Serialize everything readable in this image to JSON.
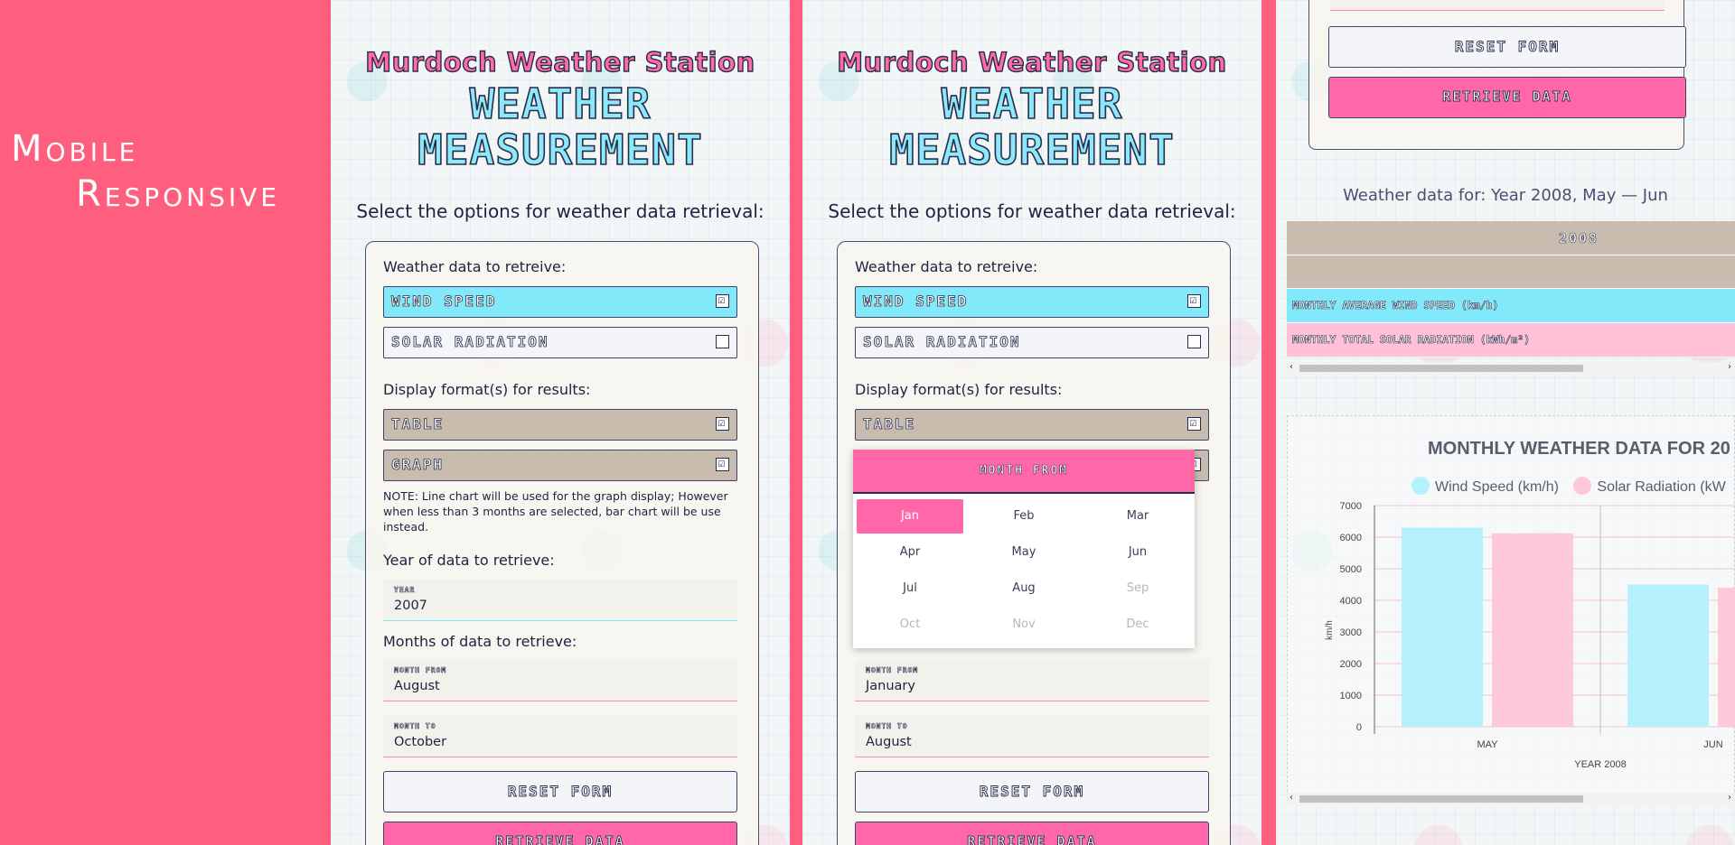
{
  "side_title": {
    "line1": "Mobile",
    "line2": "Responsive"
  },
  "form": {
    "station": "Murdoch Weather Station",
    "heading_line1": "WEATHER",
    "heading_line2": "MEASUREMENT",
    "select_prompt": "Select the options for weather data retrieval:",
    "data_label": "Weather data to retreive:",
    "wind_label": "WIND SPEED",
    "solar_label": "SOLAR RADIATION",
    "format_label": "Display format(s) for results:",
    "table_label": "TABLE",
    "graph_label": "GRAPH",
    "note": "NOTE: Line chart will be used for the graph display; However when less than 3 months are selected, bar chart will be use instead.",
    "year_label": "Year of data to retrieve:",
    "year_small": "YEAR",
    "months_label": "Months of data to retrieve:",
    "month_from_small": "MONTH FROM",
    "month_to_small": "MONTH TO",
    "reset_label": "RESET FORM",
    "retrieve_label": "RETRIEVE DATA",
    "check_mark": "☑"
  },
  "panel1": {
    "year_value": "2007",
    "month_from_value": "August",
    "month_to_value": "October"
  },
  "panel2": {
    "month_from_value": "January",
    "month_to_value": "August",
    "picker_title": "MONTH FROM",
    "months": [
      "Jan",
      "Feb",
      "Mar",
      "Apr",
      "May",
      "Jun",
      "Jul",
      "Aug",
      "Sep",
      "Oct",
      "Nov",
      "Dec"
    ],
    "selected": "Jan",
    "disabled": [
      "Sep",
      "Oct",
      "Nov",
      "Dec"
    ]
  },
  "panel3": {
    "data_for": "Weather data for: Year 2008, May — Jun",
    "table_year": "2008",
    "row_wind": "MONTHLY AVERAGE WIND SPEED (km/h)",
    "row_solar": "MONTHLY TOTAL SOLAR RADIATION (kWh/m²)",
    "scroll_left": "‹",
    "scroll_right": "›"
  },
  "colors": {
    "wind": "#82e9fb",
    "solar": "#ffc0d8",
    "accent": "#ff67a8",
    "background": "#ff5f7e"
  },
  "chart_data": {
    "type": "bar",
    "title": "MONTHLY WEATHER DATA FOR 20",
    "ylabel": "km/h",
    "xlabel": "YEAR 2008",
    "categories": [
      "MAY",
      "JUN"
    ],
    "series": [
      {
        "name": "Wind Speed (km/h)",
        "values": [
          6300,
          4500
        ],
        "color": "#b4f1fc"
      },
      {
        "name": "Solar Radiation (kW",
        "values": [
          6120,
          4400
        ],
        "color": "#ffc8da"
      }
    ],
    "ylim": [
      0,
      7000
    ],
    "yticks": [
      0,
      1000,
      2000,
      3000,
      4000,
      5000,
      6000,
      7000
    ],
    "legend": "top",
    "grid": true
  }
}
